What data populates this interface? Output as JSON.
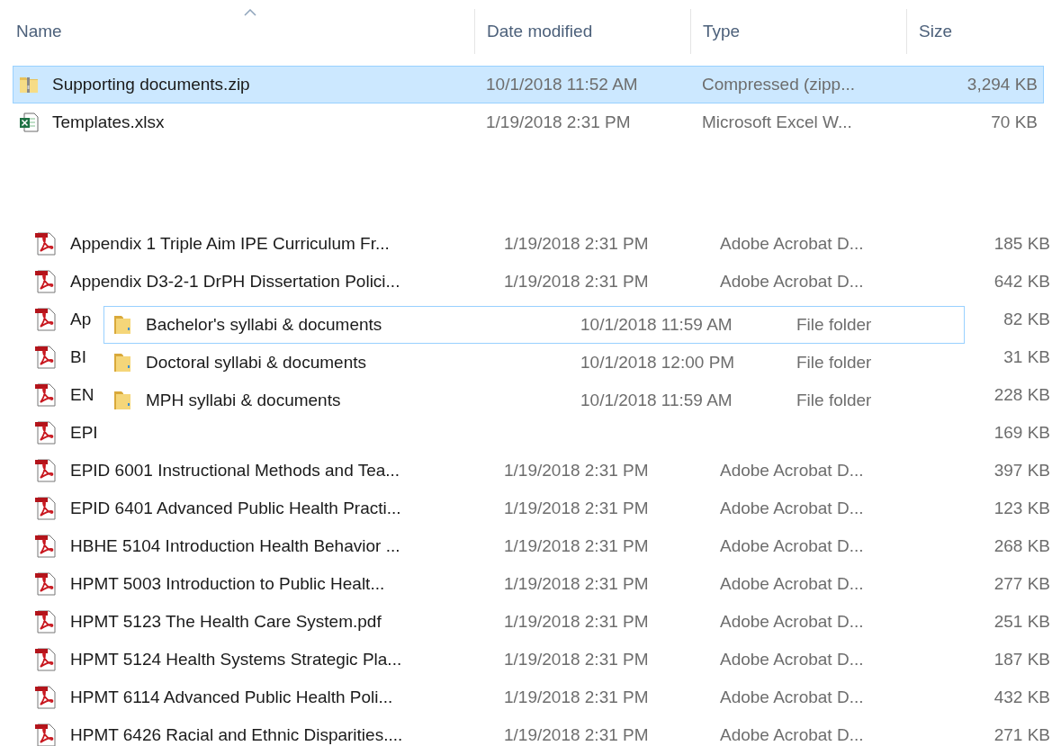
{
  "top_pane": {
    "columns": [
      {
        "label": "Name",
        "sorted": true
      },
      {
        "label": "Date modified",
        "sorted": false
      },
      {
        "label": "Type",
        "sorted": false
      },
      {
        "label": "Size",
        "sorted": false
      }
    ],
    "rows": [
      {
        "kind": "zip",
        "name": "Supporting documents.zip",
        "date": "10/1/2018 11:52 AM",
        "type": "Compressed (zipp...",
        "size": "3,294 KB",
        "selected": true
      },
      {
        "kind": "excel",
        "name": "Templates.xlsx",
        "date": "1/19/2018 2:31 PM",
        "type": "Microsoft Excel W...",
        "size": "70 KB",
        "selected": false
      }
    ]
  },
  "lower_pane": {
    "rows": [
      {
        "kind": "pdf",
        "name": "Appendix 1 Triple Aim IPE Curriculum Fr...",
        "date": "1/19/2018 2:31 PM",
        "type": "Adobe Acrobat D...",
        "size": "185 KB"
      },
      {
        "kind": "pdf",
        "name": "Appendix D3-2-1 DrPH Dissertation Polici...",
        "date": "1/19/2018 2:31 PM",
        "type": "Adobe Acrobat D...",
        "size": "642 KB"
      },
      {
        "kind": "pdf",
        "name": "Ap",
        "size": "82 KB"
      },
      {
        "kind": "pdf",
        "name": "BI",
        "size": "31 KB"
      },
      {
        "kind": "pdf",
        "name": "EN",
        "size": "228 KB"
      },
      {
        "kind": "pdf",
        "name": "EPI",
        "size": "169 KB"
      },
      {
        "kind": "pdf",
        "name": "EPID 6001 Instructional Methods and Tea...",
        "date": "1/19/2018 2:31 PM",
        "type": "Adobe Acrobat D...",
        "size": "397 KB"
      },
      {
        "kind": "pdf",
        "name": "EPID 6401 Advanced Public Health Practi...",
        "date": "1/19/2018 2:31 PM",
        "type": "Adobe Acrobat D...",
        "size": "123 KB"
      },
      {
        "kind": "pdf",
        "name": "HBHE 5104 Introduction Health Behavior ...",
        "date": "1/19/2018 2:31 PM",
        "type": "Adobe Acrobat D...",
        "size": "268 KB"
      },
      {
        "kind": "pdf",
        "name": "HPMT 5003 Introduction to Public Healt...",
        "date": "1/19/2018 2:31 PM",
        "type": "Adobe Acrobat D...",
        "size": "277 KB"
      },
      {
        "kind": "pdf",
        "name": "HPMT 5123 The Health Care System.pdf",
        "date": "1/19/2018 2:31 PM",
        "type": "Adobe Acrobat D...",
        "size": "251 KB"
      },
      {
        "kind": "pdf",
        "name": "HPMT 5124 Health Systems Strategic Pla...",
        "date": "1/19/2018 2:31 PM",
        "type": "Adobe Acrobat D...",
        "size": "187 KB"
      },
      {
        "kind": "pdf",
        "name": "HPMT 6114 Advanced Public Health Poli...",
        "date": "1/19/2018 2:31 PM",
        "type": "Adobe Acrobat D...",
        "size": "432 KB"
      },
      {
        "kind": "pdf",
        "name": "HPMT 6426 Racial and Ethnic Disparities....",
        "date": "1/19/2018 2:31 PM",
        "type": "Adobe Acrobat D...",
        "size": "271 KB"
      }
    ]
  },
  "folder_pane": {
    "rows": [
      {
        "kind": "folder",
        "name": "Bachelor's syllabi & documents",
        "date": "10/1/2018 11:59 AM",
        "type": "File folder",
        "selected": true
      },
      {
        "kind": "folder",
        "name": "Doctoral syllabi & documents",
        "date": "10/1/2018 12:00 PM",
        "type": "File folder",
        "selected": false
      },
      {
        "kind": "folder",
        "name": "MPH syllabi & documents",
        "date": "10/1/2018 11:59 AM",
        "type": "File folder",
        "selected": false
      }
    ]
  }
}
